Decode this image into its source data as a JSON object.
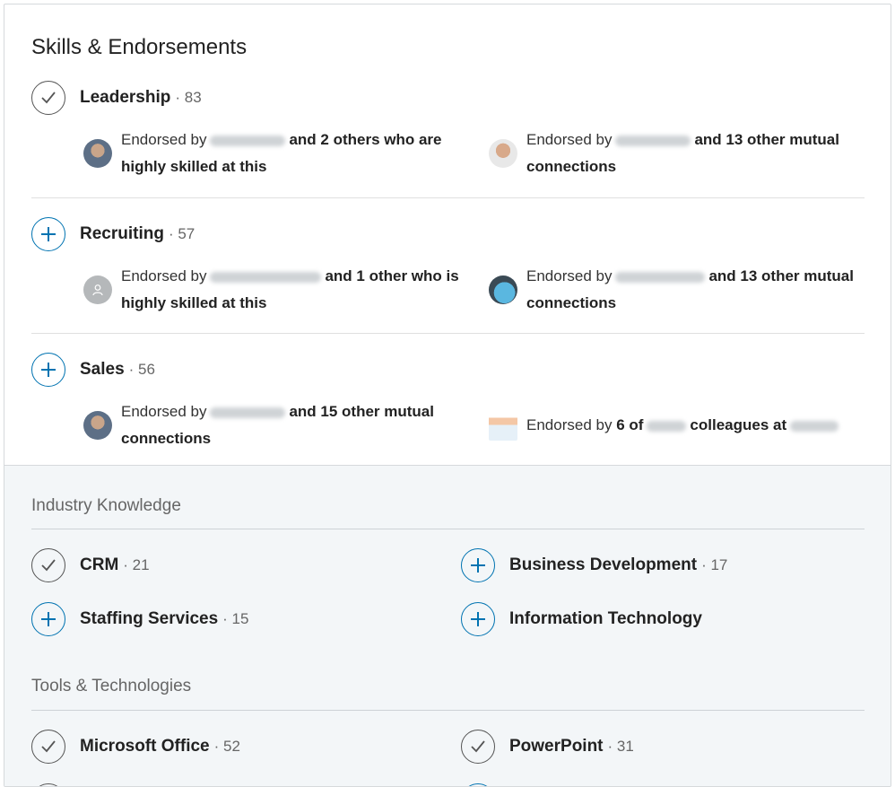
{
  "section_title": "Skills & Endorsements",
  "top_skills": [
    {
      "name": "Leadership",
      "count": "· 83",
      "state": "endorsed",
      "left": {
        "prefix": "Endorsed by",
        "suffix": "and 2 others who are",
        "line2": "highly skilled at this"
      },
      "right": {
        "prefix": "Endorsed by",
        "suffix": "and 13 other mutual",
        "line2": "connections"
      }
    },
    {
      "name": "Recruiting",
      "count": "· 57",
      "state": "add",
      "left": {
        "prefix": "Endorsed by",
        "suffix": "and 1 other who is",
        "line2": "highly skilled at this"
      },
      "right": {
        "prefix": "Endorsed by",
        "suffix": "and 13 other mutual",
        "line2": "connections"
      }
    },
    {
      "name": "Sales",
      "count": "· 56",
      "state": "add",
      "left": {
        "prefix": "Endorsed by",
        "suffix": "and 15 other mutual",
        "line2": "connections"
      },
      "right": {
        "prefix": "Endorsed by",
        "bold1": "6 of",
        "mid": "colleagues at"
      }
    }
  ],
  "categories": [
    {
      "title": "Industry Knowledge",
      "skills": [
        {
          "name": "CRM",
          "count": "· 21",
          "state": "endorsed"
        },
        {
          "name": "Business Development",
          "count": "· 17",
          "state": "add"
        },
        {
          "name": "Staffing Services",
          "count": "· 15",
          "state": "add"
        },
        {
          "name": "Information Technology",
          "count": "",
          "state": "add"
        }
      ]
    },
    {
      "title": "Tools & Technologies",
      "skills": [
        {
          "name": "Microsoft Office",
          "count": "· 52",
          "state": "endorsed"
        },
        {
          "name": "PowerPoint",
          "count": "· 31",
          "state": "endorsed"
        }
      ]
    }
  ],
  "colors": {
    "accent": "#0073b1",
    "check": "#555555",
    "panel": "#f3f6f8"
  }
}
